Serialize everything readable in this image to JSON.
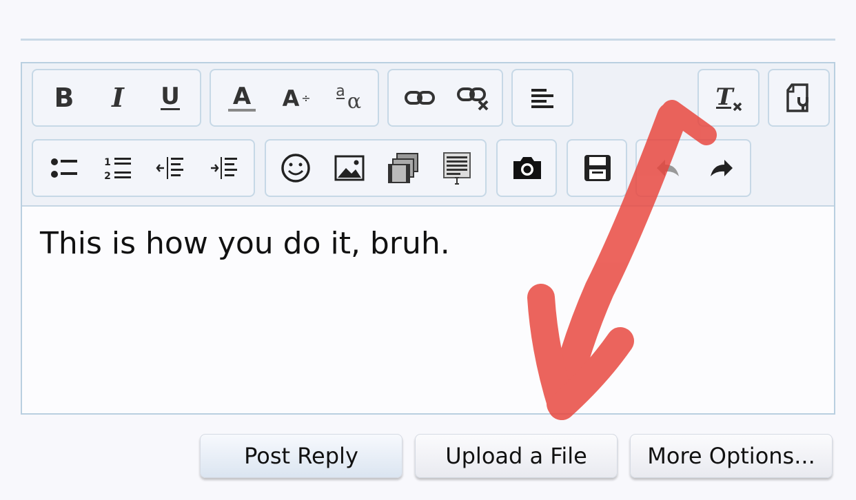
{
  "editor": {
    "content_text": "This is how you do it, bruh.",
    "toolbar_row1": [
      {
        "group": "text-style",
        "buttons": [
          "bold-icon",
          "italic-icon",
          "underline-icon"
        ]
      },
      {
        "group": "font",
        "buttons": [
          "text-color-icon",
          "font-size-icon",
          "font-family-icon"
        ]
      },
      {
        "group": "link",
        "buttons": [
          "link-icon",
          "unlink-icon"
        ]
      },
      {
        "group": "align",
        "buttons": [
          "align-left-icon"
        ]
      },
      {
        "group": "format",
        "buttons": [
          "remove-format-icon"
        ]
      },
      {
        "group": "source",
        "buttons": [
          "toggle-bbcode-icon"
        ]
      }
    ],
    "toolbar_row2": [
      {
        "group": "lists",
        "buttons": [
          "bullet-list-icon",
          "numbered-list-icon",
          "outdent-icon",
          "indent-icon"
        ]
      },
      {
        "group": "insert",
        "buttons": [
          "smilie-icon",
          "image-icon",
          "media-icon",
          "code-icon"
        ]
      },
      {
        "group": "attach",
        "buttons": [
          "camera-icon"
        ]
      },
      {
        "group": "draft",
        "buttons": [
          "save-draft-icon"
        ]
      },
      {
        "group": "history",
        "buttons": [
          "undo-icon",
          "redo-icon"
        ]
      }
    ],
    "annotation": {
      "type": "hand-drawn-arrow",
      "color": "#e8433a",
      "points_to": "upload-file-button"
    }
  },
  "form_actions": {
    "post_reply": "Post Reply",
    "upload_file": "Upload a File",
    "more_options": "More Options..."
  },
  "colors": {
    "border": "#b9cfe0",
    "toolbar_bg": "#eef1f7",
    "arrow": "#e8433a"
  }
}
